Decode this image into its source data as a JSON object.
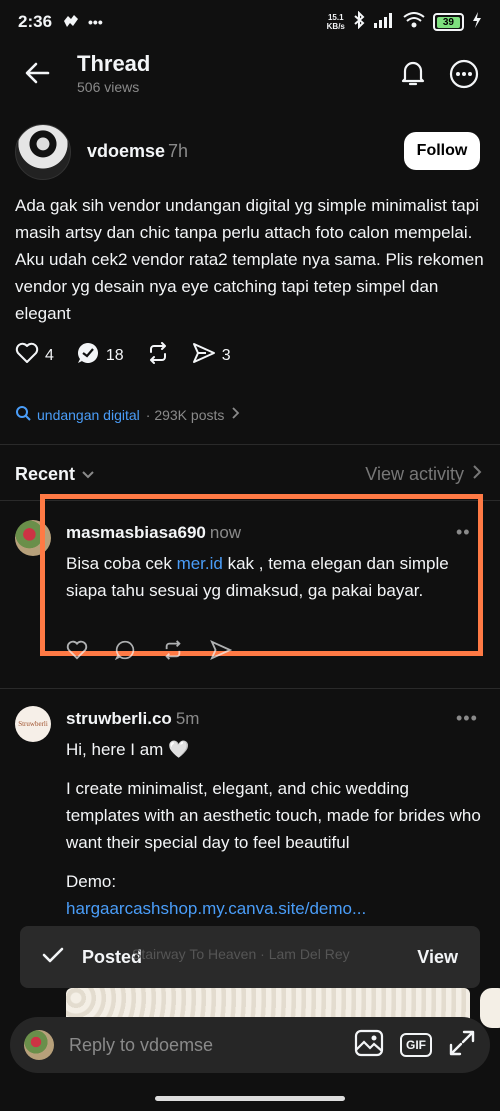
{
  "status_bar": {
    "time": "2:36",
    "net_speed_value": "15.1",
    "net_speed_unit": "KB/s",
    "battery": "39"
  },
  "header": {
    "title": "Thread",
    "views": "506 views"
  },
  "post": {
    "username": "vdoemse",
    "time": "7h",
    "follow_label": "Follow",
    "text": "Ada gak sih vendor undangan digital yg simple minimalist tapi masih artsy dan chic tanpa perlu attach foto calon mempelai. Aku udah cek2 vendor rata2 template nya sama. Plis rekomen vendor yg desain nya eye catching tapi tetep simpel dan elegant",
    "likes": "4",
    "replies": "18",
    "shares": "3"
  },
  "topic": {
    "tag": "undangan digital",
    "count": "· 293K posts"
  },
  "recent_bar": {
    "sort_label": "Recent",
    "view_activity": "View activity"
  },
  "reply1": {
    "username": "masmasbiasa690",
    "time": "now",
    "text_before": "Bisa coba cek ",
    "link": "mer.id",
    "text_after": " kak , tema elegan dan simple siapa tahu sesuai yg dimaksud, ga pakai bayar."
  },
  "reply2": {
    "username": "struwberli.co",
    "time": "5m",
    "avatar_text": "Struwberli",
    "line1": "Hi, here I am 🤍",
    "line2": "I create minimalist, elegant, and chic wedding templates with an aesthetic touch, made for brides who want their special day to feel beautiful",
    "demo_label": "Demo:",
    "demo_link": "hargaarcashshop.my.canva.site/demo..."
  },
  "toast": {
    "label": "Posted",
    "ghost": "Stairway To Heaven · Lam Del Rey",
    "action": "View"
  },
  "reply_bar": {
    "placeholder": "Reply to vdoemse",
    "gif_label": "GIF"
  }
}
